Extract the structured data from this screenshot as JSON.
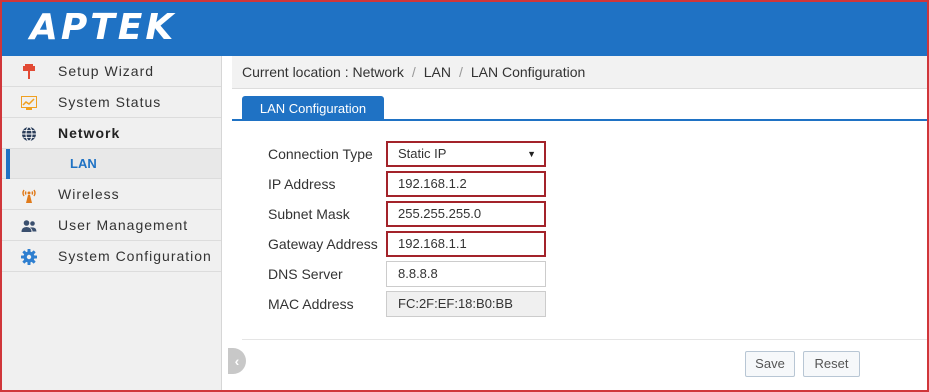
{
  "brand": {
    "logo_text": "APTEK"
  },
  "colors": {
    "primary": "#1f72c4",
    "highlight_border": "#a3232a",
    "frame_border": "#d0363a"
  },
  "sidebar": {
    "items": [
      {
        "label": "Setup Wizard",
        "icon": "wizard-icon",
        "icon_color": "#e24a34"
      },
      {
        "label": "System Status",
        "icon": "status-chart-icon",
        "icon_color": "#f0a020"
      },
      {
        "label": "Network",
        "icon": "globe-icon",
        "icon_color": "#2b3e5a",
        "active": true
      },
      {
        "label": "LAN",
        "sub": true,
        "selected": true
      },
      {
        "label": "Wireless",
        "icon": "wireless-antenna-icon",
        "icon_color": "#e07a1a"
      },
      {
        "label": "User Management",
        "icon": "users-icon",
        "icon_color": "#3a4f6e"
      },
      {
        "label": "System Configuration",
        "icon": "gear-icon",
        "icon_color": "#2e7fd0"
      }
    ]
  },
  "breadcrumb": {
    "prefix": "Current location : ",
    "parts": [
      "Network",
      "LAN",
      "LAN Configuration"
    ]
  },
  "tab": {
    "label": "LAN Configuration"
  },
  "form": {
    "connection_type": {
      "label": "Connection Type",
      "value": "Static IP"
    },
    "ip_address": {
      "label": "IP Address",
      "value": "192.168.1.2"
    },
    "subnet_mask": {
      "label": "Subnet Mask",
      "value": "255.255.255.0"
    },
    "gateway": {
      "label": "Gateway Address",
      "value": "192.168.1.1"
    },
    "dns": {
      "label": "DNS Server",
      "value": "8.8.8.8"
    },
    "mac": {
      "label": "MAC Address",
      "value": "FC:2F:EF:18:B0:BB"
    }
  },
  "buttons": {
    "save": "Save",
    "reset": "Reset"
  }
}
